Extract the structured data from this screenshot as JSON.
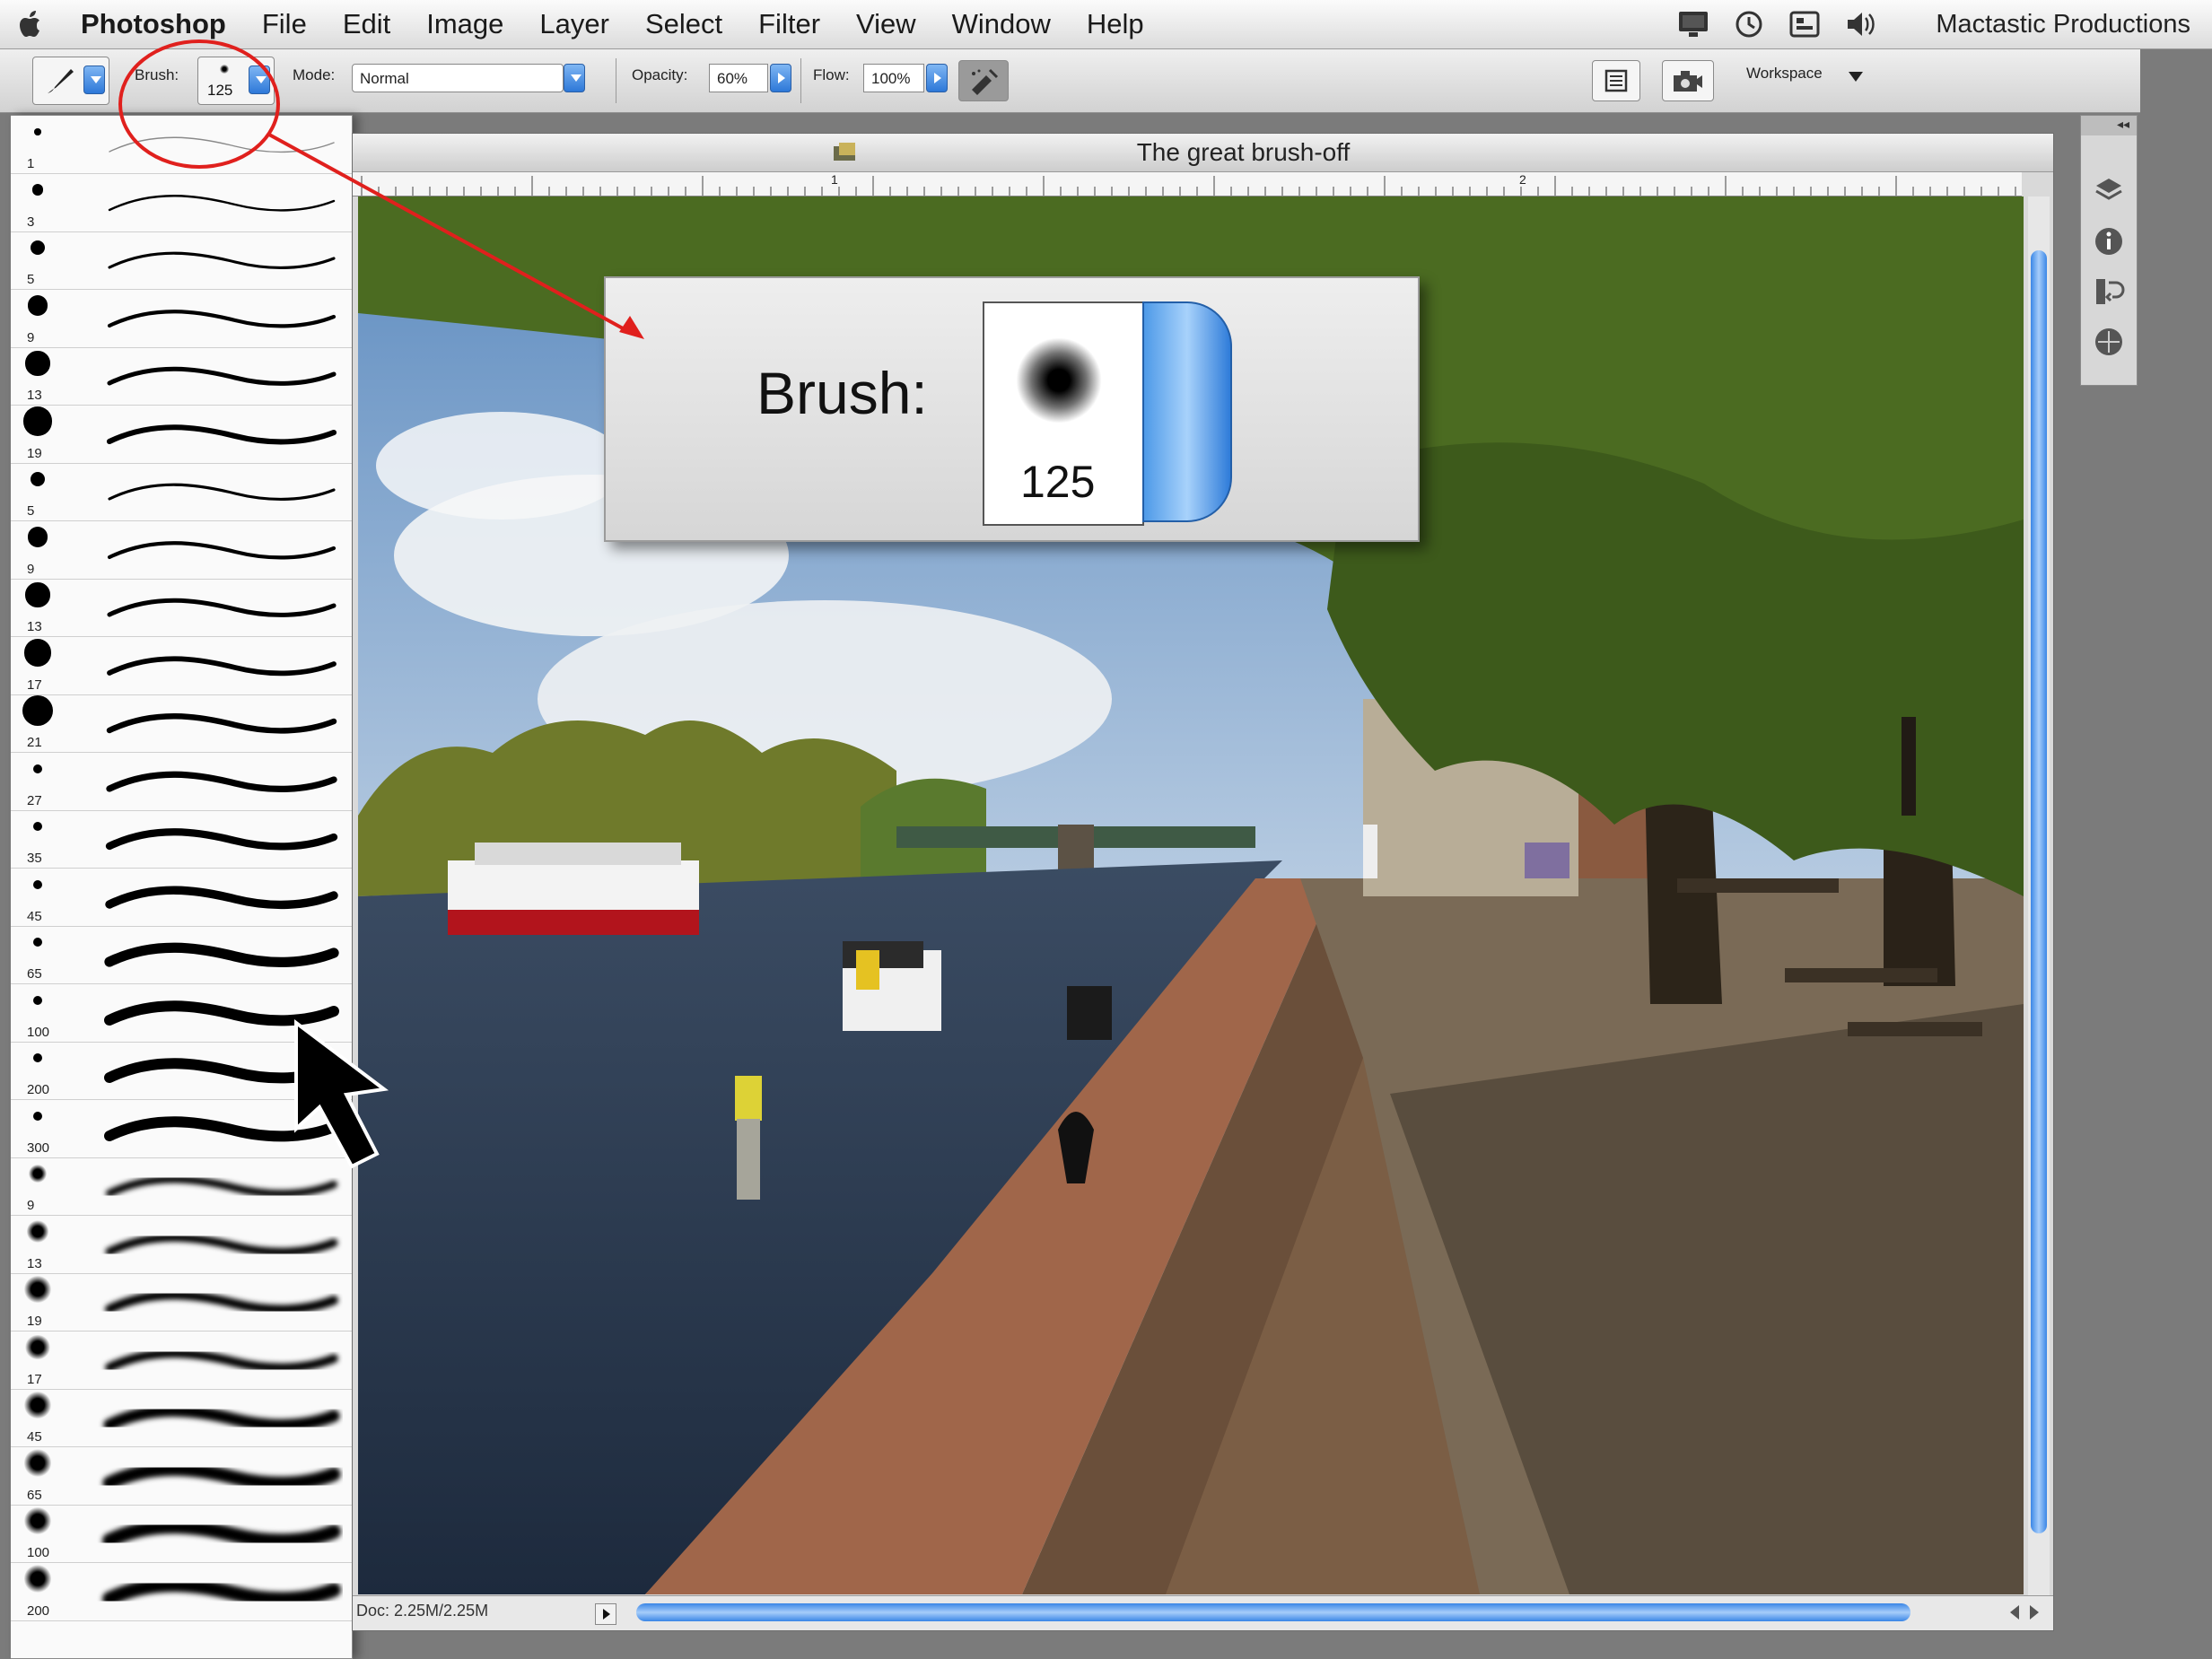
{
  "menubar": {
    "app_name": "Photoshop",
    "menus": [
      "File",
      "Edit",
      "Image",
      "Layer",
      "Select",
      "Filter",
      "View",
      "Window",
      "Help"
    ],
    "status_icons": [
      "display-icon",
      "time-machine-icon",
      "input-menu-icon",
      "volume-icon"
    ],
    "owner": "Mactastic Productions"
  },
  "options_bar": {
    "brush_label": "Brush:",
    "brush_size": "125",
    "mode_label": "Mode:",
    "mode_value": "Normal",
    "opacity_label": "Opacity:",
    "opacity_value": "60%",
    "flow_label": "Flow:",
    "flow_value": "100%",
    "workspace_label": "Workspace"
  },
  "brush_presets": [
    {
      "size": "1",
      "soft": false
    },
    {
      "size": "3",
      "soft": false
    },
    {
      "size": "5",
      "soft": false
    },
    {
      "size": "9",
      "soft": false
    },
    {
      "size": "13",
      "soft": false
    },
    {
      "size": "19",
      "soft": false
    },
    {
      "size": "5",
      "soft": false
    },
    {
      "size": "9",
      "soft": false
    },
    {
      "size": "13",
      "soft": false
    },
    {
      "size": "17",
      "soft": false
    },
    {
      "size": "21",
      "soft": false
    },
    {
      "size": "27",
      "soft": false
    },
    {
      "size": "35",
      "soft": false
    },
    {
      "size": "45",
      "soft": false
    },
    {
      "size": "65",
      "soft": false
    },
    {
      "size": "100",
      "soft": false
    },
    {
      "size": "200",
      "soft": false
    },
    {
      "size": "300",
      "soft": false
    },
    {
      "size": "9",
      "soft": true
    },
    {
      "size": "13",
      "soft": true
    },
    {
      "size": "19",
      "soft": true
    },
    {
      "size": "17",
      "soft": true
    },
    {
      "size": "45",
      "soft": true
    },
    {
      "size": "65",
      "soft": true
    },
    {
      "size": "100",
      "soft": true
    },
    {
      "size": "200",
      "soft": true
    }
  ],
  "document": {
    "title": "The great brush-off",
    "ruler_marks": [
      "1",
      "2"
    ],
    "doc_size": "Doc: 2.25M/2.25M"
  },
  "callout": {
    "label": "Brush:",
    "size": "125"
  },
  "colors": {
    "accent_blue": "#2f7cd9",
    "annotation_red": "#e0201d"
  }
}
